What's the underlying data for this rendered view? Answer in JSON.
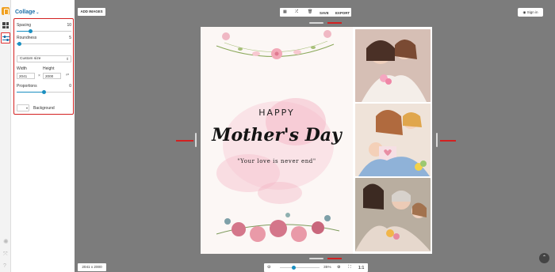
{
  "sidebar": {
    "title": "Collage",
    "spacing_label": "Spacing",
    "spacing_value": "10",
    "spacing_level": 0.25,
    "roundness_label": "Roundness",
    "roundness_value": "5",
    "roundness_level": 0.05,
    "size_select": "Custom size",
    "width_label": "Width",
    "height_label": "Height",
    "width_value": "2041",
    "height_value": "2000",
    "times": "×",
    "proportions_label": "Proportions",
    "proportions_value": "0",
    "proportions_level": 0.5,
    "background_label": "Background"
  },
  "toolbar": {
    "add_images": "ADD IMAGES",
    "save": "SAVE",
    "export": "EXPORT",
    "sign_in": "Sign in"
  },
  "card": {
    "happy": "HAPPY",
    "mothers_day": "Mother's Day",
    "quote": "\"Your love is never end\""
  },
  "footer": {
    "dims": "2041 x 2000",
    "zoom": "35%",
    "ratio": "1:1",
    "zoom_level": 0.35
  },
  "colors": {
    "accent": "#1a8fc0",
    "highlight": "#d32020",
    "brand": "#1a6ea8"
  }
}
